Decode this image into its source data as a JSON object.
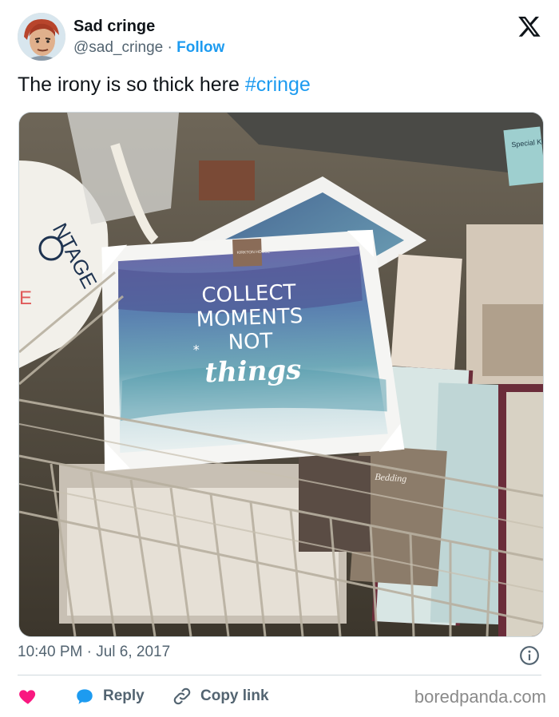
{
  "author": {
    "name": "Sad cringe",
    "handle": "@sad_cringe",
    "separator": "·",
    "follow_label": "Follow"
  },
  "tweet": {
    "text": "The irony is so thick here ",
    "hashtag": "#cringe",
    "timestamp": "10:40 PM · Jul 6, 2017"
  },
  "photo": {
    "frame_text_line1": "COLLECT",
    "frame_text_line2": "MOMENTS",
    "frame_text_line3": "NOT",
    "frame_text_line4": "things",
    "sticker_text": "KIRKTON HOUSE",
    "package_label": "Bedding",
    "shelf_tag": "Special King Sheet"
  },
  "actions": {
    "reply_label": "Reply",
    "copy_label": "Copy link"
  },
  "watermark": "boredpanda.com",
  "colors": {
    "accent": "#1d9bf0",
    "heart": "#f91880",
    "text": "#0f1419",
    "muted": "#536471"
  },
  "icons": [
    "x-logo-icon",
    "info-icon",
    "heart-icon",
    "reply-bubble-icon",
    "link-icon"
  ]
}
